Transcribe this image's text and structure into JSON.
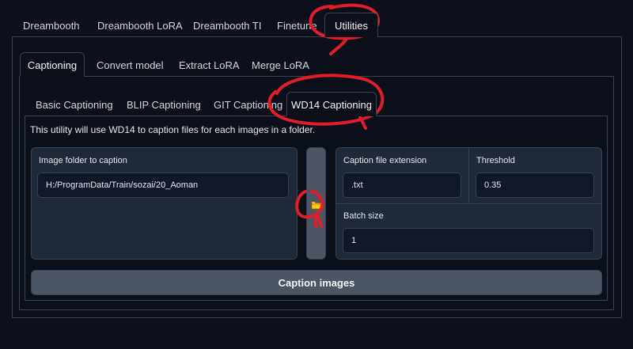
{
  "top_tabs": [
    "Dreambooth",
    "Dreambooth LoRA",
    "Dreambooth TI",
    "Finetune",
    "Utilities"
  ],
  "sub_tabs": [
    "Captioning",
    "Convert model",
    "Extract LoRA",
    "Merge LoRA"
  ],
  "caption_tabs": [
    "Basic Captioning",
    "BLIP Captioning",
    "GIT Captioning",
    "WD14 Captioning"
  ],
  "description": "This utility will use WD14 to caption files for each images in a folder.",
  "image_folder": {
    "label": "Image folder to caption",
    "value": "H:/ProgramData/Train/sozai/20_Aoman"
  },
  "folder_button_icon": "folder-icon",
  "caption_ext": {
    "label": "Caption file extension",
    "value": ".txt"
  },
  "threshold": {
    "label": "Threshold",
    "value": "0.35"
  },
  "batch_size": {
    "label": "Batch size",
    "value": "1"
  },
  "caption_button": "Caption images",
  "colors": {
    "background": "#0b0f19",
    "panel": "#1f2937",
    "border": "#374151",
    "annotation": "#e11d2a"
  }
}
